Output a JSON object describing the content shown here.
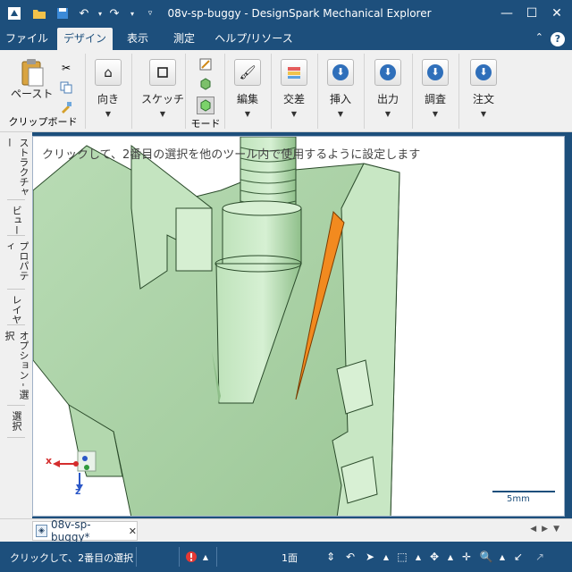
{
  "window": {
    "title": "08v-sp-buggy - DesignSpark Mechanical Explorer"
  },
  "menu": {
    "tabs": [
      {
        "label": "ファイル",
        "active": false
      },
      {
        "label": "デザイン",
        "active": true
      },
      {
        "label": "表示",
        "active": false
      },
      {
        "label": "測定",
        "active": false
      },
      {
        "label": "ヘルプ/リソース",
        "active": false
      }
    ]
  },
  "ribbon": {
    "clipboard": {
      "paste_label": "ペースト",
      "group_label": "クリップボード"
    },
    "orient_label": "向き",
    "sketch_label": "スケッチ",
    "mode_label": "モード",
    "edit_label": "編集",
    "intersect_label": "交差",
    "insert_label": "挿入",
    "output_label": "出力",
    "inspect_label": "調査",
    "order_label": "注文"
  },
  "side_tabs": [
    "ストラクチャー",
    "ビュー",
    "プロパティ",
    "レイヤ",
    "オプション - 選択",
    "選択"
  ],
  "viewport": {
    "hint": "クリックして、2番目の選択を他のツール内で使用するように設定します",
    "scale_label": "5mm",
    "axis_x": "x",
    "axis_z": "z",
    "colors": {
      "part": "#bfe0bb",
      "selected_face": "#f28a1f",
      "edge": "#2a4a2a"
    }
  },
  "doc_tab": {
    "label": "08v-sp-buggy*"
  },
  "status": {
    "text": "クリックして、2番目の選択",
    "face_count": "1面"
  }
}
